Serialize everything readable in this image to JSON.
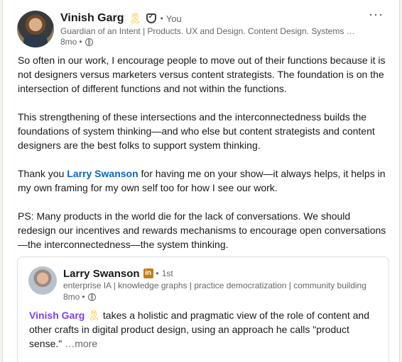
{
  "post": {
    "author_name": "Vinish Garg",
    "ribbon_icon": "yellow-ribbon",
    "verified_icon": "verified-shield",
    "relationship": "You",
    "headline": "Guardian of an Intent | Products. UX and Design. Content Design. Systems Thinking",
    "time": "8mo",
    "visibility_icon": "globe",
    "menu_label": "···",
    "paragraphs": [
      "So often in our work, I encourage people to move out of their functions because it is not designers versus marketers versus content strategists. The foundation is on the intersection of different functions and not within the functions.",
      "This strengthening of these intersections and the interconnectedness builds the foundations of system thinking—and who else but content strategists and content designers are the best folks to support system thinking."
    ],
    "thanks_before": "Thank you ",
    "thanks_mention": "Larry Swanson",
    "thanks_after": " for having me on your show—it always helps, it helps in my own framing for my own self too for how I see our work.",
    "ps": "PS: Many products in the world die for the lack of conversations. We should redesign our incentives and rewards mechanisms to encourage open conversations—the interconnectedness—the system thinking."
  },
  "reshare": {
    "author_name": "Larry Swanson",
    "badge": "in",
    "degree": "1st",
    "headline": "enterprise IA | knowledge graphs | practice democratization | community building",
    "time": "8mo",
    "mention": "Vinish Garg",
    "text_after": " takes a holistic and pragmatic view of the role of content and other crafts in digital product design, using an approach he calls \"product sense.\"",
    "see_more": "…more"
  },
  "colors": {
    "link_blue": "#0a66c2",
    "mention_purple": "#7e3ff2",
    "ribbon_yellow": "#f2b705",
    "badge_gold": "#c37d16"
  }
}
